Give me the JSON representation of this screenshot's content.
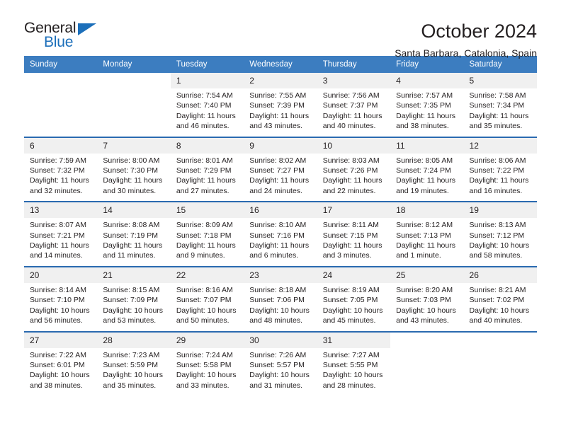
{
  "logo": {
    "line1": "General",
    "line2": "Blue",
    "accent_color": "#1c6fba"
  },
  "header": {
    "title": "October 2024",
    "subtitle": "Santa Barbara, Catalonia, Spain"
  },
  "calendar": {
    "header_bg": "#3c7dc0",
    "daynum_bg": "#f0f0f0",
    "week_rule_color": "#2a6ab0",
    "weekdays": [
      "Sunday",
      "Monday",
      "Tuesday",
      "Wednesday",
      "Thursday",
      "Friday",
      "Saturday"
    ],
    "weeks": [
      [
        {
          "day": ""
        },
        {
          "day": ""
        },
        {
          "day": "1",
          "sunrise": "Sunrise: 7:54 AM",
          "sunset": "Sunset: 7:40 PM",
          "daylight1": "Daylight: 11 hours",
          "daylight2": "and 46 minutes."
        },
        {
          "day": "2",
          "sunrise": "Sunrise: 7:55 AM",
          "sunset": "Sunset: 7:39 PM",
          "daylight1": "Daylight: 11 hours",
          "daylight2": "and 43 minutes."
        },
        {
          "day": "3",
          "sunrise": "Sunrise: 7:56 AM",
          "sunset": "Sunset: 7:37 PM",
          "daylight1": "Daylight: 11 hours",
          "daylight2": "and 40 minutes."
        },
        {
          "day": "4",
          "sunrise": "Sunrise: 7:57 AM",
          "sunset": "Sunset: 7:35 PM",
          "daylight1": "Daylight: 11 hours",
          "daylight2": "and 38 minutes."
        },
        {
          "day": "5",
          "sunrise": "Sunrise: 7:58 AM",
          "sunset": "Sunset: 7:34 PM",
          "daylight1": "Daylight: 11 hours",
          "daylight2": "and 35 minutes."
        }
      ],
      [
        {
          "day": "6",
          "sunrise": "Sunrise: 7:59 AM",
          "sunset": "Sunset: 7:32 PM",
          "daylight1": "Daylight: 11 hours",
          "daylight2": "and 32 minutes."
        },
        {
          "day": "7",
          "sunrise": "Sunrise: 8:00 AM",
          "sunset": "Sunset: 7:30 PM",
          "daylight1": "Daylight: 11 hours",
          "daylight2": "and 30 minutes."
        },
        {
          "day": "8",
          "sunrise": "Sunrise: 8:01 AM",
          "sunset": "Sunset: 7:29 PM",
          "daylight1": "Daylight: 11 hours",
          "daylight2": "and 27 minutes."
        },
        {
          "day": "9",
          "sunrise": "Sunrise: 8:02 AM",
          "sunset": "Sunset: 7:27 PM",
          "daylight1": "Daylight: 11 hours",
          "daylight2": "and 24 minutes."
        },
        {
          "day": "10",
          "sunrise": "Sunrise: 8:03 AM",
          "sunset": "Sunset: 7:26 PM",
          "daylight1": "Daylight: 11 hours",
          "daylight2": "and 22 minutes."
        },
        {
          "day": "11",
          "sunrise": "Sunrise: 8:05 AM",
          "sunset": "Sunset: 7:24 PM",
          "daylight1": "Daylight: 11 hours",
          "daylight2": "and 19 minutes."
        },
        {
          "day": "12",
          "sunrise": "Sunrise: 8:06 AM",
          "sunset": "Sunset: 7:22 PM",
          "daylight1": "Daylight: 11 hours",
          "daylight2": "and 16 minutes."
        }
      ],
      [
        {
          "day": "13",
          "sunrise": "Sunrise: 8:07 AM",
          "sunset": "Sunset: 7:21 PM",
          "daylight1": "Daylight: 11 hours",
          "daylight2": "and 14 minutes."
        },
        {
          "day": "14",
          "sunrise": "Sunrise: 8:08 AM",
          "sunset": "Sunset: 7:19 PM",
          "daylight1": "Daylight: 11 hours",
          "daylight2": "and 11 minutes."
        },
        {
          "day": "15",
          "sunrise": "Sunrise: 8:09 AM",
          "sunset": "Sunset: 7:18 PM",
          "daylight1": "Daylight: 11 hours",
          "daylight2": "and 9 minutes."
        },
        {
          "day": "16",
          "sunrise": "Sunrise: 8:10 AM",
          "sunset": "Sunset: 7:16 PM",
          "daylight1": "Daylight: 11 hours",
          "daylight2": "and 6 minutes."
        },
        {
          "day": "17",
          "sunrise": "Sunrise: 8:11 AM",
          "sunset": "Sunset: 7:15 PM",
          "daylight1": "Daylight: 11 hours",
          "daylight2": "and 3 minutes."
        },
        {
          "day": "18",
          "sunrise": "Sunrise: 8:12 AM",
          "sunset": "Sunset: 7:13 PM",
          "daylight1": "Daylight: 11 hours",
          "daylight2": "and 1 minute."
        },
        {
          "day": "19",
          "sunrise": "Sunrise: 8:13 AM",
          "sunset": "Sunset: 7:12 PM",
          "daylight1": "Daylight: 10 hours",
          "daylight2": "and 58 minutes."
        }
      ],
      [
        {
          "day": "20",
          "sunrise": "Sunrise: 8:14 AM",
          "sunset": "Sunset: 7:10 PM",
          "daylight1": "Daylight: 10 hours",
          "daylight2": "and 56 minutes."
        },
        {
          "day": "21",
          "sunrise": "Sunrise: 8:15 AM",
          "sunset": "Sunset: 7:09 PM",
          "daylight1": "Daylight: 10 hours",
          "daylight2": "and 53 minutes."
        },
        {
          "day": "22",
          "sunrise": "Sunrise: 8:16 AM",
          "sunset": "Sunset: 7:07 PM",
          "daylight1": "Daylight: 10 hours",
          "daylight2": "and 50 minutes."
        },
        {
          "day": "23",
          "sunrise": "Sunrise: 8:18 AM",
          "sunset": "Sunset: 7:06 PM",
          "daylight1": "Daylight: 10 hours",
          "daylight2": "and 48 minutes."
        },
        {
          "day": "24",
          "sunrise": "Sunrise: 8:19 AM",
          "sunset": "Sunset: 7:05 PM",
          "daylight1": "Daylight: 10 hours",
          "daylight2": "and 45 minutes."
        },
        {
          "day": "25",
          "sunrise": "Sunrise: 8:20 AM",
          "sunset": "Sunset: 7:03 PM",
          "daylight1": "Daylight: 10 hours",
          "daylight2": "and 43 minutes."
        },
        {
          "day": "26",
          "sunrise": "Sunrise: 8:21 AM",
          "sunset": "Sunset: 7:02 PM",
          "daylight1": "Daylight: 10 hours",
          "daylight2": "and 40 minutes."
        }
      ],
      [
        {
          "day": "27",
          "sunrise": "Sunrise: 7:22 AM",
          "sunset": "Sunset: 6:01 PM",
          "daylight1": "Daylight: 10 hours",
          "daylight2": "and 38 minutes."
        },
        {
          "day": "28",
          "sunrise": "Sunrise: 7:23 AM",
          "sunset": "Sunset: 5:59 PM",
          "daylight1": "Daylight: 10 hours",
          "daylight2": "and 35 minutes."
        },
        {
          "day": "29",
          "sunrise": "Sunrise: 7:24 AM",
          "sunset": "Sunset: 5:58 PM",
          "daylight1": "Daylight: 10 hours",
          "daylight2": "and 33 minutes."
        },
        {
          "day": "30",
          "sunrise": "Sunrise: 7:26 AM",
          "sunset": "Sunset: 5:57 PM",
          "daylight1": "Daylight: 10 hours",
          "daylight2": "and 31 minutes."
        },
        {
          "day": "31",
          "sunrise": "Sunrise: 7:27 AM",
          "sunset": "Sunset: 5:55 PM",
          "daylight1": "Daylight: 10 hours",
          "daylight2": "and 28 minutes."
        },
        {
          "day": ""
        },
        {
          "day": ""
        }
      ]
    ]
  }
}
